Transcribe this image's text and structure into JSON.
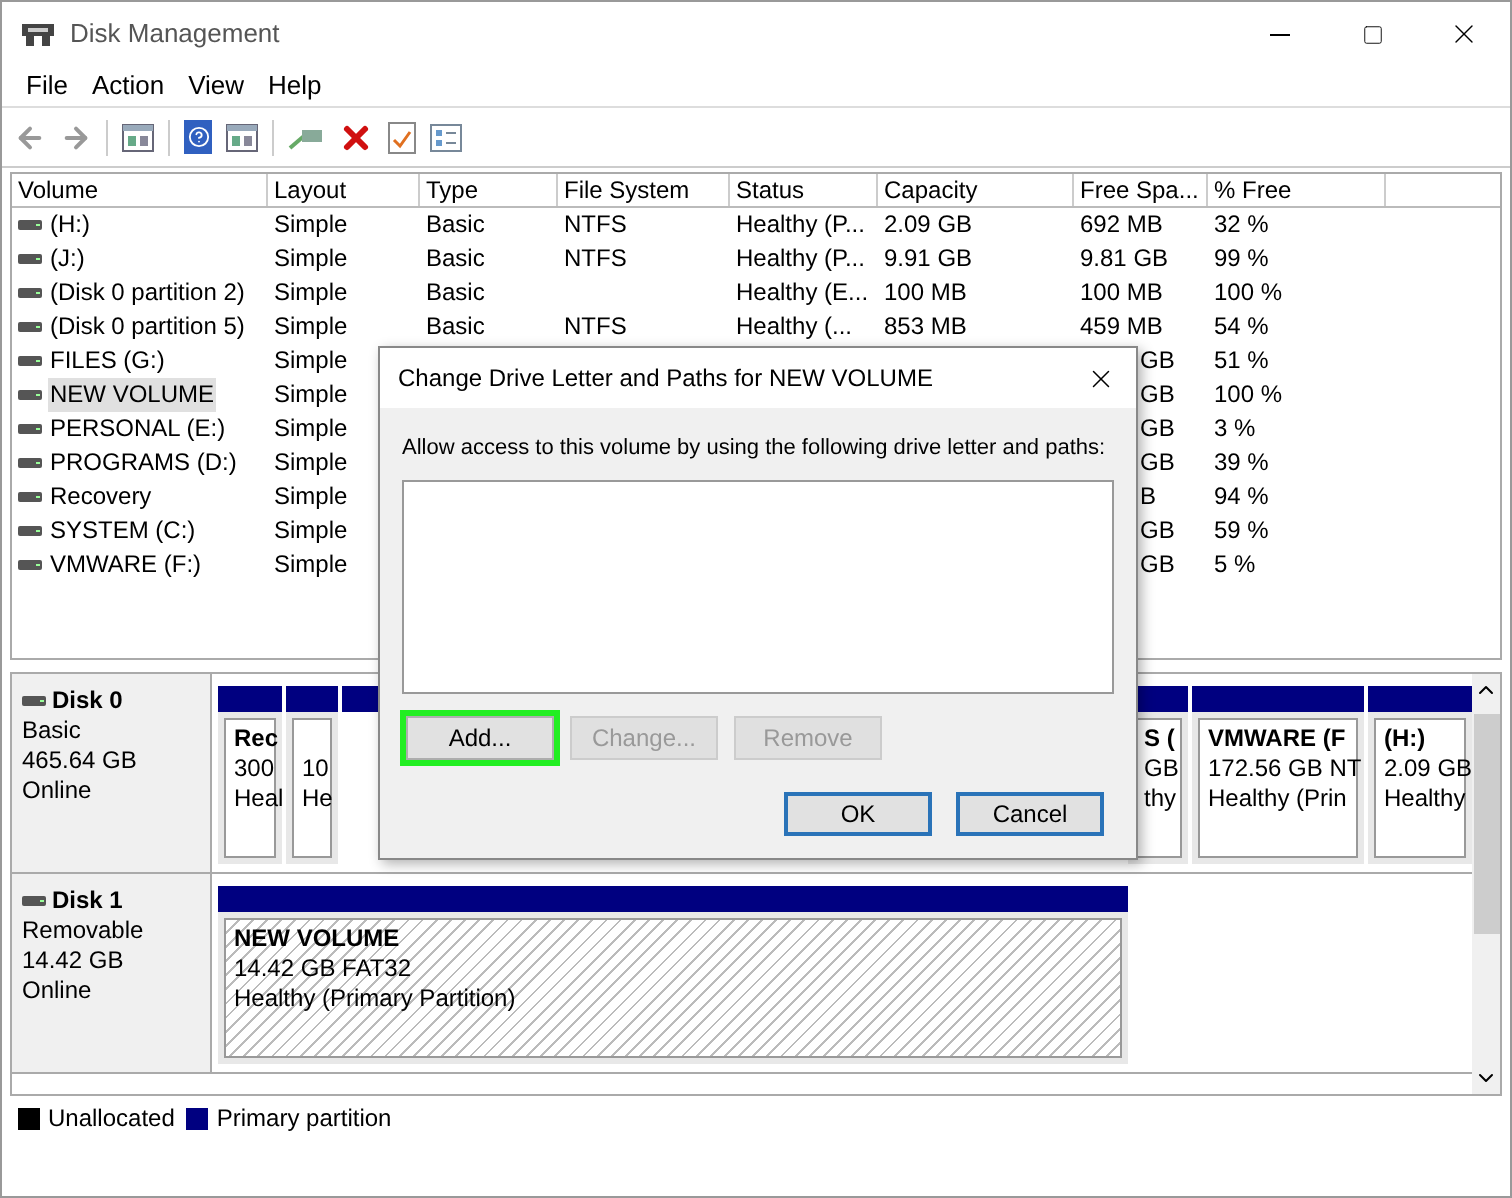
{
  "window": {
    "title": "Disk Management"
  },
  "menu": [
    "File",
    "Action",
    "View",
    "Help"
  ],
  "table": {
    "columns": [
      "Volume",
      "Layout",
      "Type",
      "File System",
      "Status",
      "Capacity",
      "Free Spa...",
      "% Free"
    ],
    "rows": [
      {
        "volume": "(H:)",
        "layout": "Simple",
        "type": "Basic",
        "file_system": "NTFS",
        "status": "Healthy (P...",
        "capacity": "2.09 GB",
        "free_space": "692 MB",
        "pct_free": "32 %",
        "selected": false
      },
      {
        "volume": "(J:)",
        "layout": "Simple",
        "type": "Basic",
        "file_system": "NTFS",
        "status": "Healthy (P...",
        "capacity": "9.91 GB",
        "free_space": "9.81 GB",
        "pct_free": "99 %",
        "selected": false
      },
      {
        "volume": "(Disk 0 partition 2)",
        "layout": "Simple",
        "type": "Basic",
        "status": "Healthy (E...",
        "capacity": "100 MB",
        "free_space": "100 MB",
        "pct_free": "100 %",
        "selected": false
      },
      {
        "volume": "(Disk 0 partition 5)",
        "layout": "Simple",
        "type": "Basic",
        "file_system": "NTFS",
        "status": "Healthy (...",
        "capacity": "853 MB",
        "free_space": "459 MB",
        "pct_free": "54 %",
        "selected": false
      },
      {
        "volume": "FILES (G:)",
        "layout": "Simple",
        "free_space_tail": "GB",
        "pct_free": "51 %",
        "selected": false
      },
      {
        "volume": "NEW VOLUME",
        "layout": "Simple",
        "free_space_tail": "GB",
        "pct_free": "100 %",
        "selected": true
      },
      {
        "volume": "PERSONAL (E:)",
        "layout": "Simple",
        "free_space_tail": "GB",
        "pct_free": "3 %",
        "selected": false
      },
      {
        "volume": "PROGRAMS (D:)",
        "layout": "Simple",
        "free_space_tail": "GB",
        "pct_free": "39 %",
        "selected": false
      },
      {
        "volume": "Recovery",
        "layout": "Simple",
        "free_space_tail": "B",
        "pct_free": "94 %",
        "selected": false
      },
      {
        "volume": "SYSTEM (C:)",
        "layout": "Simple",
        "free_space_tail": "GB",
        "pct_free": "59 %",
        "selected": false
      },
      {
        "volume": "VMWARE (F:)",
        "layout": "Simple",
        "free_space_tail": "GB",
        "pct_free": "5 %",
        "selected": false
      }
    ]
  },
  "disks": [
    {
      "name": "Disk 0",
      "type": "Basic",
      "size": "465.64 GB",
      "state": "Online",
      "partitions": [
        {
          "name": "Rec",
          "size": "300",
          "status": "Heal",
          "selected": false
        },
        {
          "size": "10",
          "status": "He",
          "selected": false
        },
        {
          "kind": "covered"
        },
        {
          "name": "S (",
          "size": "GB",
          "status": "thy",
          "selected": false
        },
        {
          "name": "VMWARE  (F",
          "size": "172.56 GB NT",
          "status": "Healthy (Prin",
          "selected": false
        },
        {
          "name": "(H:)",
          "size": "2.09 GB",
          "status": "Healthy",
          "selected": false
        }
      ]
    },
    {
      "name": "Disk 1",
      "type": "Removable",
      "size": "14.42 GB",
      "state": "Online",
      "partitions": [
        {
          "name": "NEW VOLUME",
          "size": "14.42 GB FAT32",
          "status": "Healthy (Primary Partition)",
          "selected": true
        }
      ]
    }
  ],
  "legend": [
    {
      "label": "Unallocated",
      "color": "#000000"
    },
    {
      "label": "Primary partition",
      "color": "#000080"
    }
  ],
  "dialog": {
    "title": "Change Drive Letter and Paths for NEW VOLUME",
    "prompt": "Allow access to this volume by using the following drive letter and paths:",
    "buttons": [
      {
        "label": "Add...",
        "disabled": false,
        "highlighted": true
      },
      {
        "label": "Change...",
        "disabled": true,
        "highlighted": false
      },
      {
        "label": "Remove",
        "disabled": true,
        "highlighted": false
      }
    ],
    "actions": [
      {
        "label": "OK",
        "disabled": false
      },
      {
        "label": "Cancel",
        "disabled": false
      }
    ]
  }
}
